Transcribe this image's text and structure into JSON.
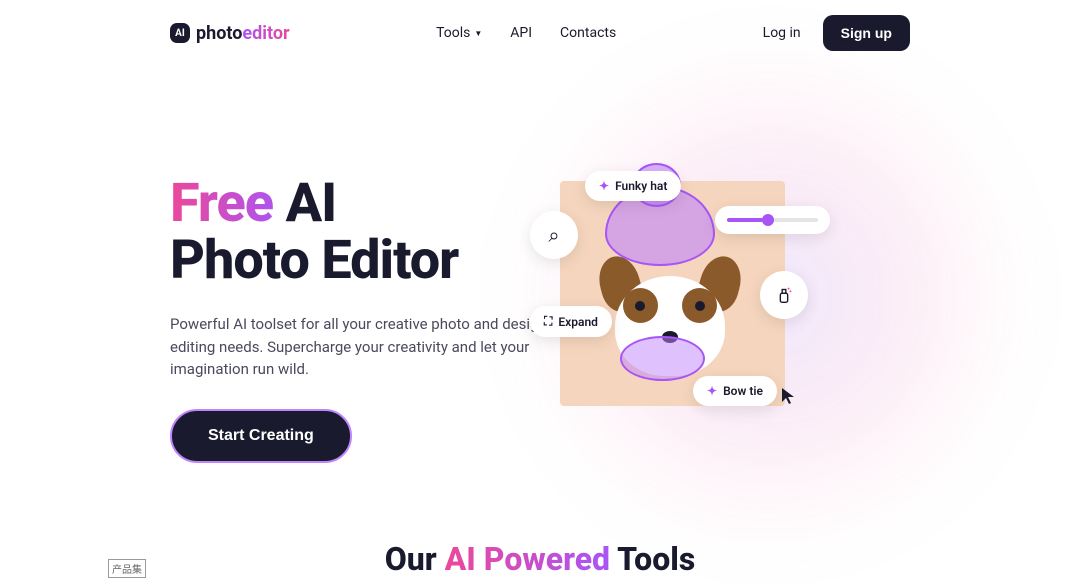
{
  "header": {
    "logo_badge": "AI",
    "logo_text_photo": "photo",
    "logo_text_editor": "editor",
    "nav": {
      "tools": "Tools",
      "api": "API",
      "contacts": "Contacts"
    },
    "auth": {
      "login": "Log in",
      "signup": "Sign up"
    }
  },
  "hero": {
    "title_free": "Free ",
    "title_rest_1": "AI",
    "title_rest_2": "Photo Editor",
    "subtitle": "Powerful AI toolset for all your creative photo and design editing needs. Supercharge your creativity and let your imagination run wild.",
    "cta": "Start Creating"
  },
  "widgets": {
    "funky_hat": "Funky hat",
    "expand": "Expand",
    "bow_tie": "Bow tie"
  },
  "section2": {
    "title_our": "Our ",
    "title_ai": "AI Powered",
    "title_tools": " Tools"
  },
  "bottom_label": "产品集"
}
